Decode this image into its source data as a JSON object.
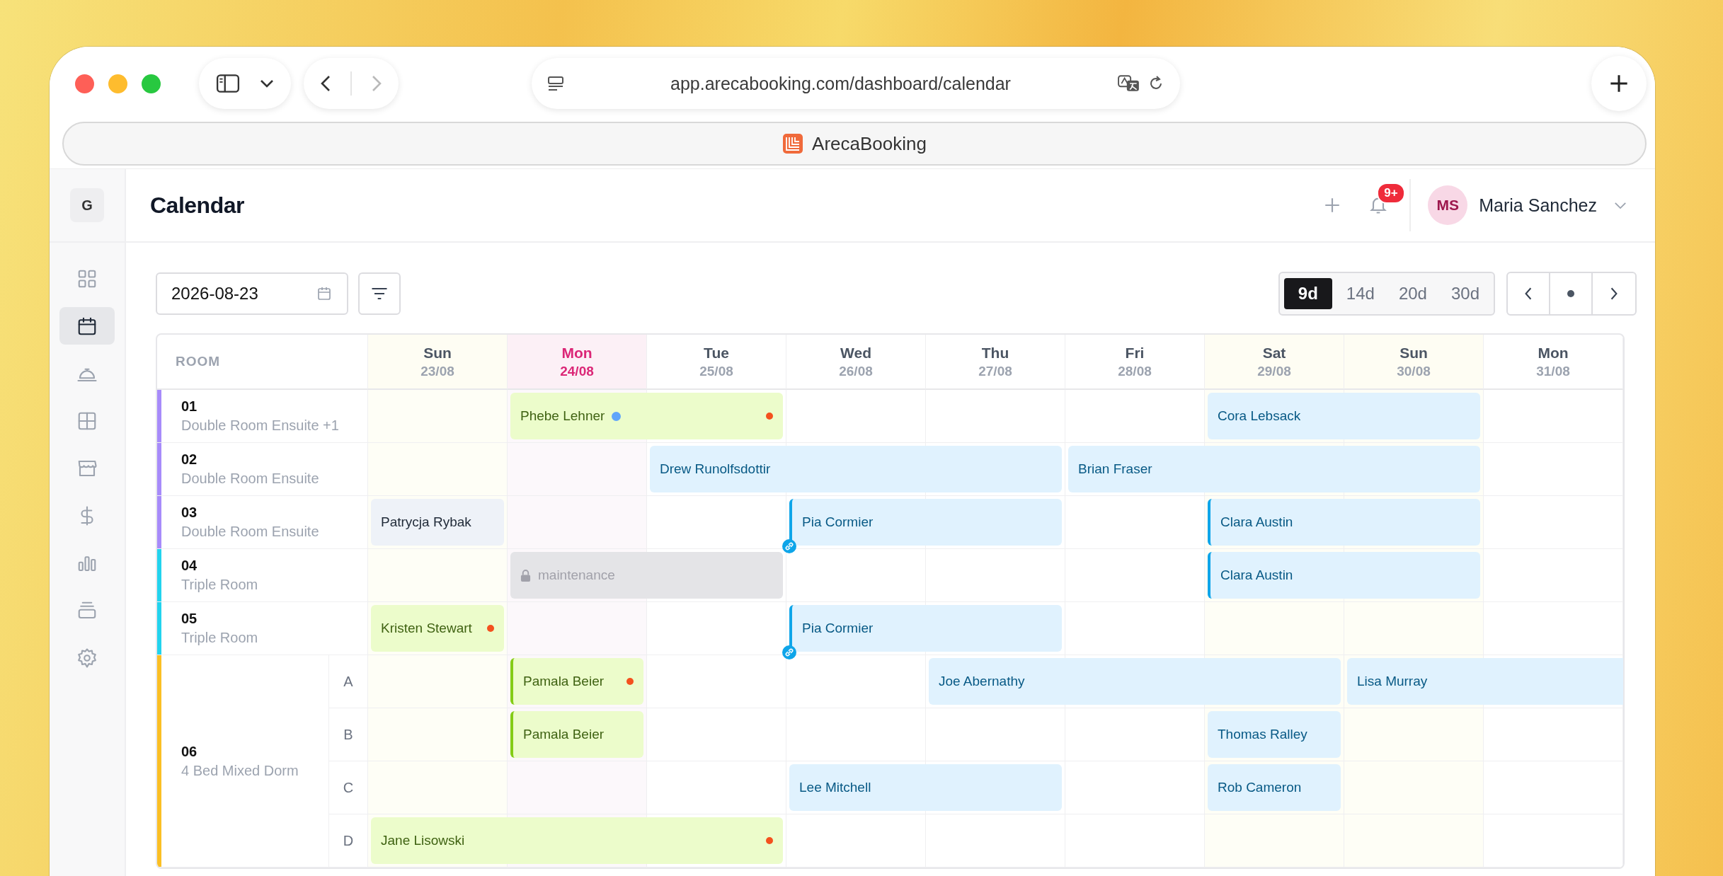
{
  "browser": {
    "url": "app.arecabooking.com/dashboard/calendar",
    "tab_title": "ArecaBooking",
    "forward_disabled": true
  },
  "sidebar": {
    "logo": "G",
    "items": [
      {
        "selected": false
      },
      {
        "selected": true
      },
      {
        "selected": false
      },
      {
        "selected": false
      },
      {
        "selected": false
      },
      {
        "selected": false
      },
      {
        "selected": false
      },
      {
        "selected": false
      },
      {
        "selected": false
      }
    ]
  },
  "header": {
    "title": "Calendar",
    "notification_badge": "9+",
    "user": {
      "initials": "MS",
      "name": "Maria Sanchez"
    }
  },
  "toolbar": {
    "date": "2026-08-23",
    "ranges": [
      {
        "label": "9d",
        "selected": true
      },
      {
        "label": "14d",
        "selected": false
      },
      {
        "label": "20d",
        "selected": false
      },
      {
        "label": "30d",
        "selected": false
      }
    ]
  },
  "calendar": {
    "room_heading": "ROOM",
    "days": [
      {
        "day": "Sun",
        "date": "23/08",
        "today": false,
        "weekend": true
      },
      {
        "day": "Mon",
        "date": "24/08",
        "today": true,
        "weekend": false
      },
      {
        "day": "Tue",
        "date": "25/08",
        "today": false,
        "weekend": false
      },
      {
        "day": "Wed",
        "date": "26/08",
        "today": false,
        "weekend": false
      },
      {
        "day": "Thu",
        "date": "27/08",
        "today": false,
        "weekend": false
      },
      {
        "day": "Fri",
        "date": "28/08",
        "today": false,
        "weekend": false
      },
      {
        "day": "Sat",
        "date": "29/08",
        "today": false,
        "weekend": true
      },
      {
        "day": "Sun",
        "date": "30/08",
        "today": false,
        "weekend": true
      },
      {
        "day": "Mon",
        "date": "31/08",
        "today": false,
        "weekend": false
      }
    ],
    "rooms": [
      {
        "number": "01",
        "type": "Double Room Ensuite +1",
        "color": "#a78bfa",
        "cells": [
          {
            "kind": "empty"
          },
          {
            "kind": "booking-green",
            "guest": "Phebe Lehner",
            "info": true,
            "alert": true
          },
          {
            "kind": "continued"
          },
          {
            "kind": "empty"
          },
          {
            "kind": "empty"
          },
          {
            "kind": "empty"
          },
          {
            "kind": "booking-blue",
            "guest": "Cora Lebsack"
          },
          {
            "kind": "continued"
          },
          {
            "kind": "empty"
          }
        ]
      },
      {
        "number": "02",
        "type": "Double Room Ensuite",
        "color": "#a78bfa",
        "cells": [
          {
            "kind": "empty"
          },
          {
            "kind": "empty"
          },
          {
            "kind": "booking-blue",
            "guest": "Drew Runolfsdottir"
          },
          {
            "kind": "continued"
          },
          {
            "kind": "continued"
          },
          {
            "kind": "booking-blue",
            "guest": "Brian Fraser"
          },
          {
            "kind": "continued"
          },
          {
            "kind": "continued"
          },
          {
            "kind": "empty"
          }
        ]
      },
      {
        "number": "03",
        "type": "Double Room Ensuite",
        "color": "#a78bfa",
        "cells": [
          {
            "kind": "booking-grey",
            "guest": "Patrycja Rybak"
          },
          {
            "kind": "empty"
          },
          {
            "kind": "empty"
          },
          {
            "kind": "booking-blue",
            "guest": "Pia Cormier",
            "accent": true,
            "linked": true
          },
          {
            "kind": "continued"
          },
          {
            "kind": "empty"
          },
          {
            "kind": "booking-blue",
            "guest": "Clara Austin",
            "accent": true
          },
          {
            "kind": "continued"
          },
          {
            "kind": "empty"
          }
        ]
      },
      {
        "number": "04",
        "type": "Triple Room",
        "color": "#22d3ee",
        "cells": [
          {
            "kind": "empty"
          },
          {
            "kind": "block",
            "label": "maintenance"
          },
          {
            "kind": "continued"
          },
          {
            "kind": "empty"
          },
          {
            "kind": "empty"
          },
          {
            "kind": "empty"
          },
          {
            "kind": "booking-blue",
            "guest": "Clara Austin",
            "accent": true
          },
          {
            "kind": "continued"
          },
          {
            "kind": "empty"
          }
        ]
      },
      {
        "number": "05",
        "type": "Triple Room",
        "color": "#22d3ee",
        "cells": [
          {
            "kind": "booking-green",
            "guest": "Kristen Stewart",
            "alert": true
          },
          {
            "kind": "empty"
          },
          {
            "kind": "empty"
          },
          {
            "kind": "booking-blue",
            "guest": "Pia Cormier",
            "accent": true,
            "linked": true
          },
          {
            "kind": "continued"
          },
          {
            "kind": "empty"
          },
          {
            "kind": "empty"
          },
          {
            "kind": "empty"
          },
          {
            "kind": "empty"
          }
        ]
      },
      {
        "number": "06",
        "type": "4 Bed Mixed Dorm",
        "color": "#fbbf24",
        "beds": [
          {
            "label": "A",
            "cells": [
              {
                "kind": "empty"
              },
              {
                "kind": "booking-green",
                "guest": "Pamala Beier",
                "accent": true,
                "alert": true
              },
              {
                "kind": "empty"
              },
              {
                "kind": "empty"
              },
              {
                "kind": "booking-blue",
                "guest": "Joe Abernathy"
              },
              {
                "kind": "continued"
              },
              {
                "kind": "continued"
              },
              {
                "kind": "booking-blue",
                "guest": "Lisa Murray",
                "cut_off": true
              },
              {
                "kind": "continued"
              }
            ]
          },
          {
            "label": "B",
            "cells": [
              {
                "kind": "empty"
              },
              {
                "kind": "booking-green",
                "guest": "Pamala Beier",
                "accent": true
              },
              {
                "kind": "empty"
              },
              {
                "kind": "empty"
              },
              {
                "kind": "empty"
              },
              {
                "kind": "empty"
              },
              {
                "kind": "booking-blue",
                "guest": "Thomas Ralley"
              },
              {
                "kind": "empty"
              },
              {
                "kind": "empty"
              }
            ]
          },
          {
            "label": "C",
            "cells": [
              {
                "kind": "empty"
              },
              {
                "kind": "empty"
              },
              {
                "kind": "empty"
              },
              {
                "kind": "booking-blue",
                "guest": "Lee Mitchell"
              },
              {
                "kind": "continued"
              },
              {
                "kind": "empty"
              },
              {
                "kind": "booking-blue",
                "guest": "Rob Cameron"
              },
              {
                "kind": "empty"
              },
              {
                "kind": "empty"
              }
            ]
          },
          {
            "label": "D",
            "cells": [
              {
                "kind": "booking-green",
                "guest": "Jane Lisowski",
                "alert": true
              },
              {
                "kind": "continued"
              },
              {
                "kind": "continued"
              },
              {
                "kind": "empty"
              },
              {
                "kind": "empty"
              },
              {
                "kind": "empty"
              },
              {
                "kind": "empty"
              },
              {
                "kind": "empty"
              },
              {
                "kind": "empty"
              }
            ]
          }
        ]
      }
    ]
  }
}
